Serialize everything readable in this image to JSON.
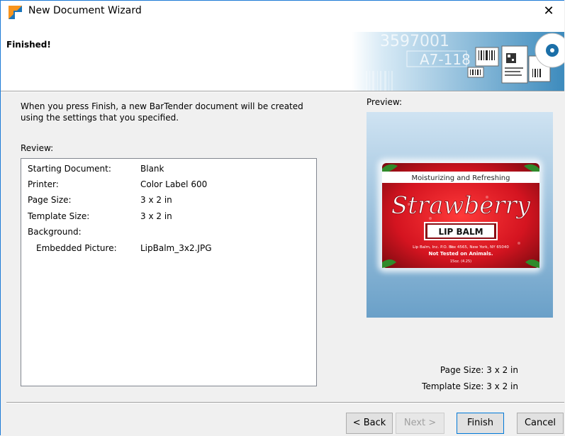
{
  "window": {
    "title": "New Document Wizard",
    "close_glyph": "✕"
  },
  "header": {
    "title": "Finished!",
    "banner": {
      "number_a": "3597001",
      "number_b": "A7-118"
    }
  },
  "main": {
    "intro_text": "When you press Finish, a new BarTender document will be created using the settings that you specified.",
    "review_label": "Review:",
    "review_rows": [
      {
        "key": "Starting Document:",
        "value": "Blank"
      },
      {
        "key": "Printer:",
        "value": "Color Label 600"
      },
      {
        "key": "Page Size:",
        "value": "3 x 2 in"
      },
      {
        "key": "Template Size:",
        "value": "3 x 2 in"
      },
      {
        "key": "Background:",
        "value": ""
      },
      {
        "key": "Embedded Picture:",
        "value": "LipBalm_3x2.JPG"
      }
    ],
    "preview": {
      "label": "Preview:",
      "label_image": {
        "tagline": "Moisturizing and Refreshing",
        "product": "Strawberry",
        "subtitle": "LIP BALM",
        "address": "Lip Balm, Inc. P.O. Box 4565, New York, NY 65040",
        "claim": "Not Tested on Animals.",
        "size": "15oz. (4.25)"
      },
      "page_size": "Page Size:  3 x 2 in",
      "template_size": "Template Size:  3 x 2 in"
    }
  },
  "buttons": {
    "back": "< Back",
    "next": "Next >",
    "finish": "Finish",
    "cancel": "Cancel"
  },
  "colors": {
    "accent": "#0078d7",
    "label_red": "#d8202c"
  }
}
